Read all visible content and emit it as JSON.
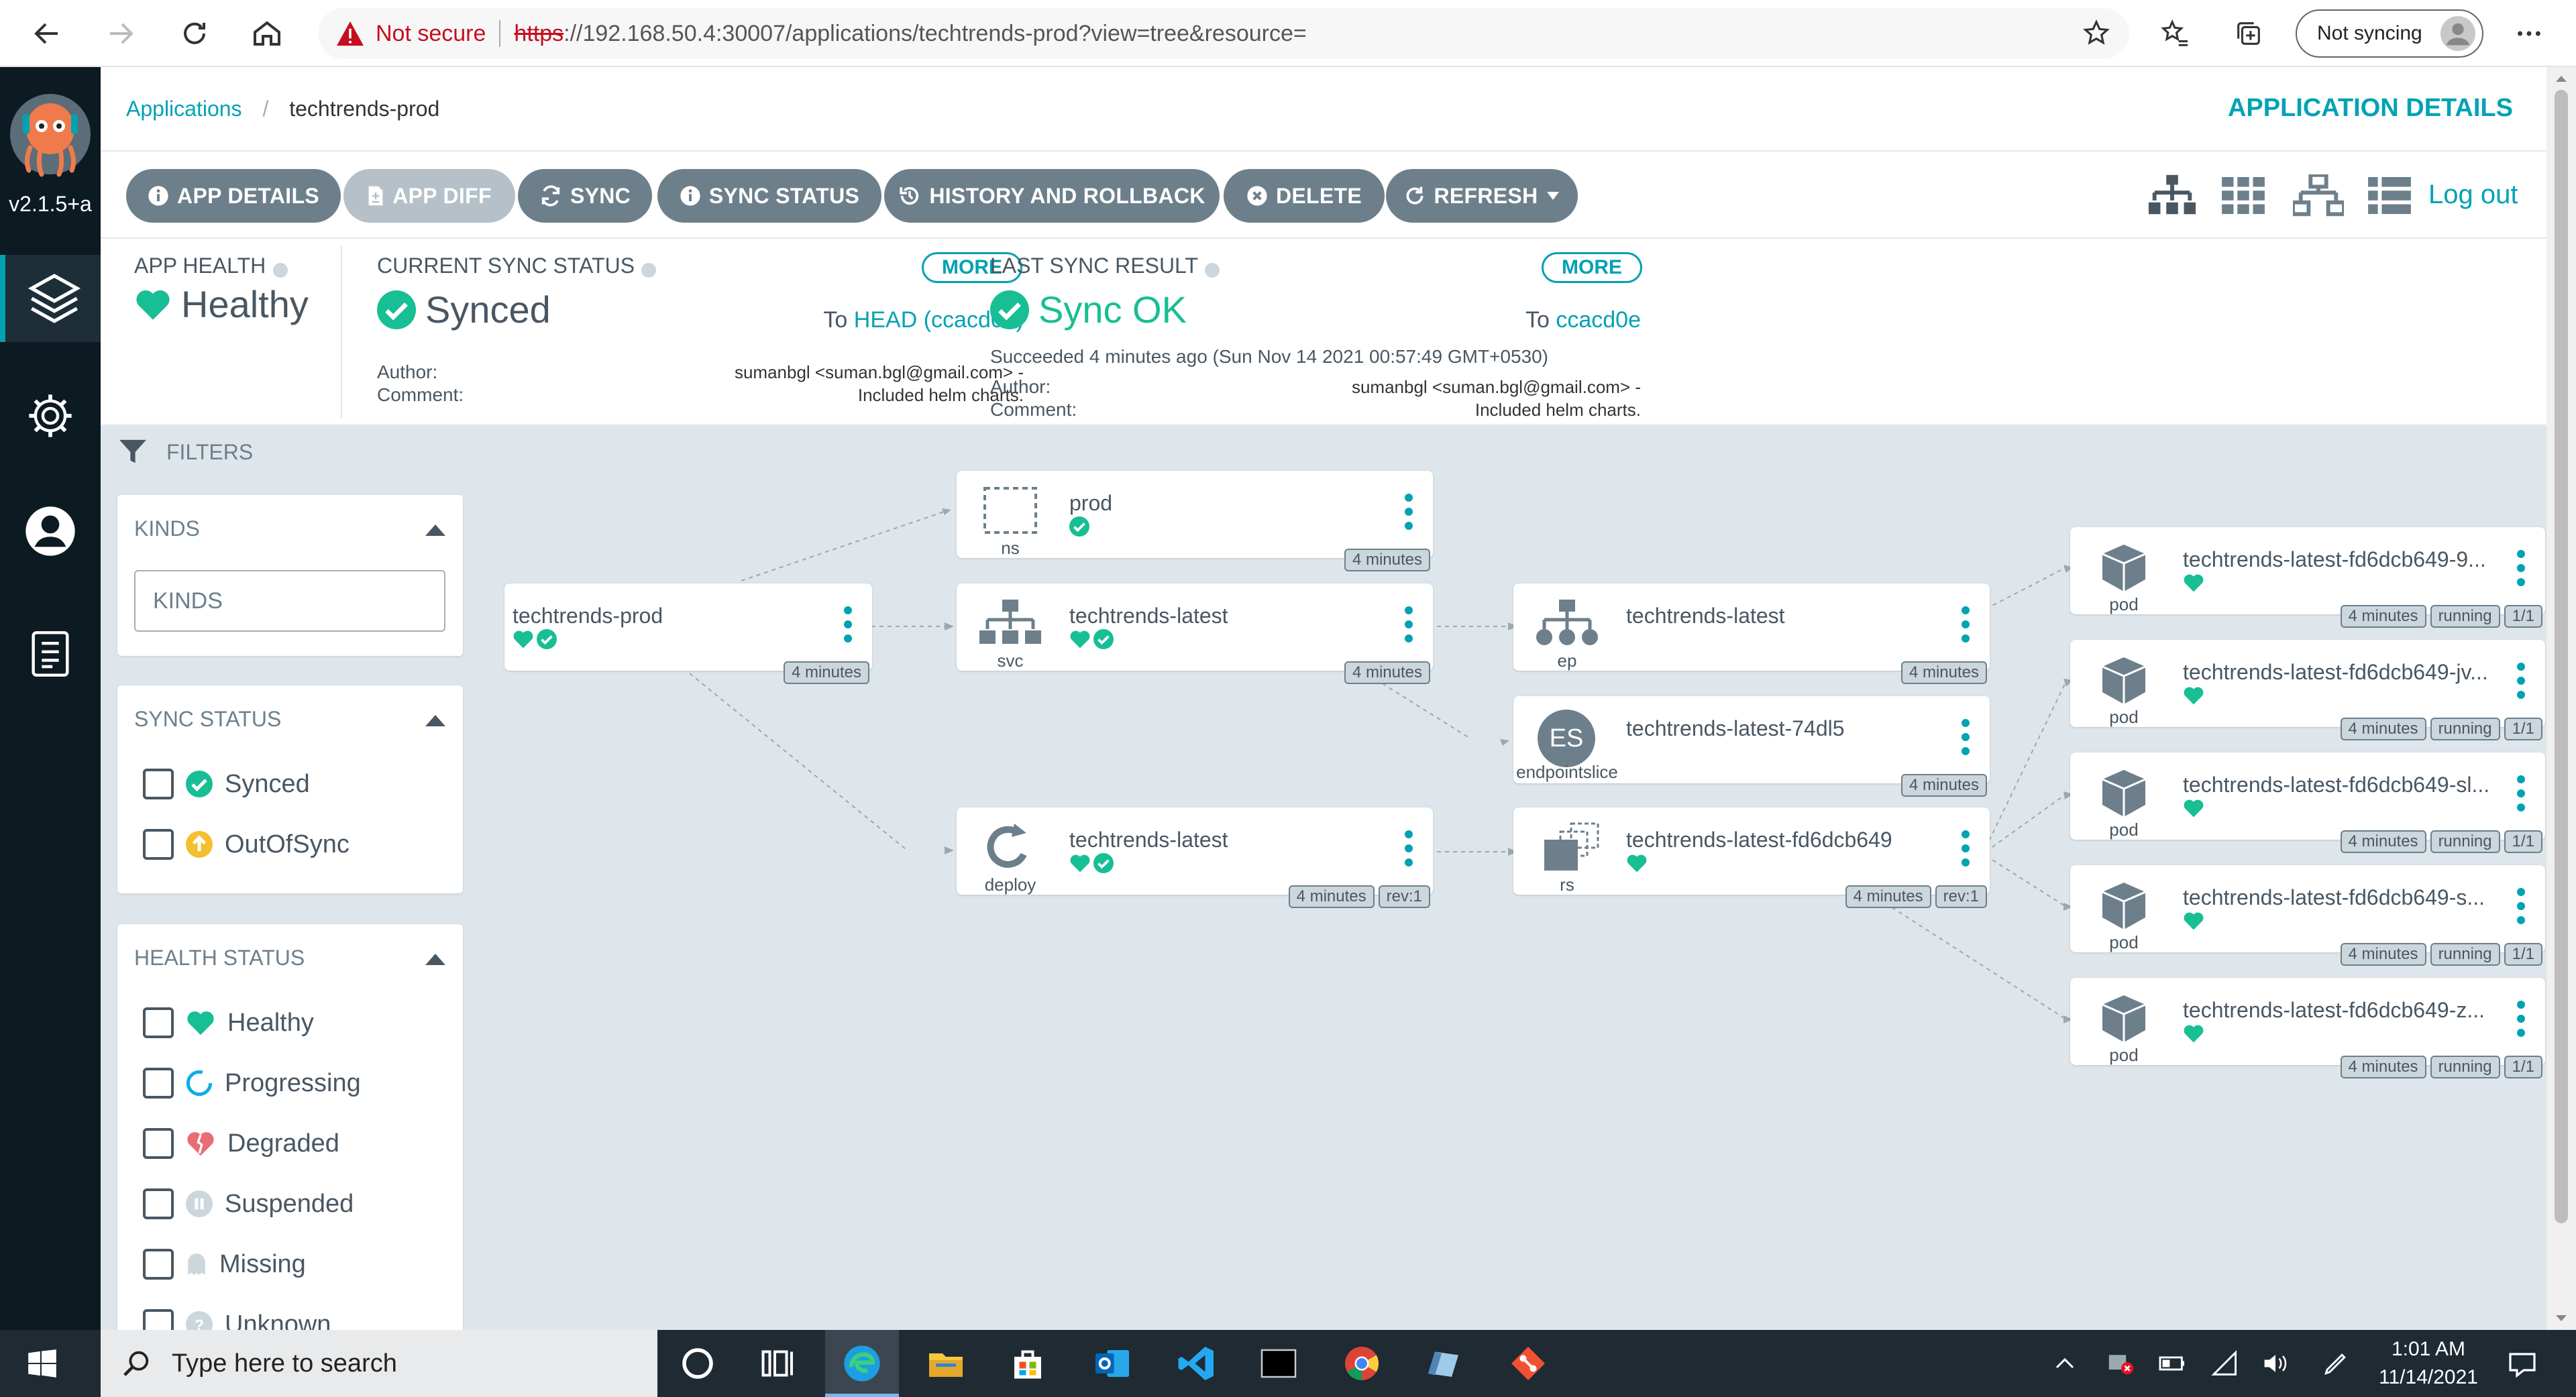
{
  "browser": {
    "security_label": "Not secure",
    "url_scheme": "https",
    "url_rest": "://192.168.50.4:30007/applications/techtrends-prod?view=tree&resource=",
    "profile_status": "Not syncing"
  },
  "nav": {
    "version": "v2.1.5+a"
  },
  "breadcrumb": {
    "root": "Applications",
    "current": "techtrends-prod"
  },
  "page_heading": "APPLICATION DETAILS",
  "toolbar": {
    "app_details": "APP DETAILS",
    "app_diff": "APP DIFF",
    "sync": "SYNC",
    "sync_status": "SYNC STATUS",
    "history": "HISTORY AND ROLLBACK",
    "delete": "DELETE",
    "refresh": "REFRESH",
    "logout": "Log out"
  },
  "summary": {
    "app_health_label": "APP HEALTH",
    "app_health_value": "Healthy",
    "current_sync_label": "CURRENT SYNC STATUS",
    "current_sync_value": "Synced",
    "current_sync_to": "To",
    "current_sync_rev": "HEAD (ccacd0e)",
    "more": "MORE",
    "author_label": "Author:",
    "comment_label": "Comment:",
    "author_value": "sumanbgl <suman.bgl@gmail.com> -",
    "comment_value": "Included helm charts.",
    "last_sync_label": "LAST SYNC RESULT",
    "last_sync_value": "Sync OK",
    "last_sync_to": "To",
    "last_sync_rev": "ccacd0e",
    "last_sync_detail": "Succeeded 4 minutes ago (Sun Nov 14 2021 00:57:49 GMT+0530)"
  },
  "filters": {
    "title": "FILTERS",
    "kinds_title": "KINDS",
    "kinds_placeholder": "KINDS",
    "sync_title": "SYNC STATUS",
    "sync_options": [
      "Synced",
      "OutOfSync"
    ],
    "health_title": "HEALTH STATUS",
    "health_options": [
      "Healthy",
      "Progressing",
      "Degraded",
      "Suspended",
      "Missing",
      "Unknown"
    ]
  },
  "graph": {
    "app": {
      "name": "techtrends-prod",
      "age": "4 minutes"
    },
    "ns": {
      "name": "prod",
      "kind": "ns",
      "age": "4 minutes"
    },
    "svc": {
      "name": "techtrends-latest",
      "kind": "svc",
      "age": "4 minutes"
    },
    "deploy": {
      "name": "techtrends-latest",
      "kind": "deploy",
      "age": "4 minutes",
      "rev": "rev:1"
    },
    "ep": {
      "name": "techtrends-latest",
      "kind": "ep",
      "age": "4 minutes"
    },
    "eps": {
      "name": "techtrends-latest-74dl5",
      "kind": "endpointslice",
      "badge": "ES",
      "age": "4 minutes"
    },
    "rs": {
      "name": "techtrends-latest-fd6dcb649",
      "kind": "rs",
      "age": "4 minutes",
      "rev": "rev:1"
    },
    "pods": [
      {
        "name": "techtrends-latest-fd6dcb649-9...",
        "kind": "pod",
        "age": "4 minutes",
        "status": "running",
        "ready": "1/1"
      },
      {
        "name": "techtrends-latest-fd6dcb649-jv...",
        "kind": "pod",
        "age": "4 minutes",
        "status": "running",
        "ready": "1/1"
      },
      {
        "name": "techtrends-latest-fd6dcb649-sl...",
        "kind": "pod",
        "age": "4 minutes",
        "status": "running",
        "ready": "1/1"
      },
      {
        "name": "techtrends-latest-fd6dcb649-s...",
        "kind": "pod",
        "age": "4 minutes",
        "status": "running",
        "ready": "1/1"
      },
      {
        "name": "techtrends-latest-fd6dcb649-z...",
        "kind": "pod",
        "age": "4 minutes",
        "status": "running",
        "ready": "1/1"
      }
    ]
  },
  "taskbar": {
    "search_placeholder": "Type here to search",
    "time": "1:01 AM",
    "date": "11/14/2021"
  },
  "colors": {
    "accent": "#00a2b3",
    "healthy": "#18be94",
    "nav_bg": "#0c1a22",
    "button": "#6d7f8b",
    "out_of_sync": "#f4c030",
    "degraded": "#e96d76"
  }
}
